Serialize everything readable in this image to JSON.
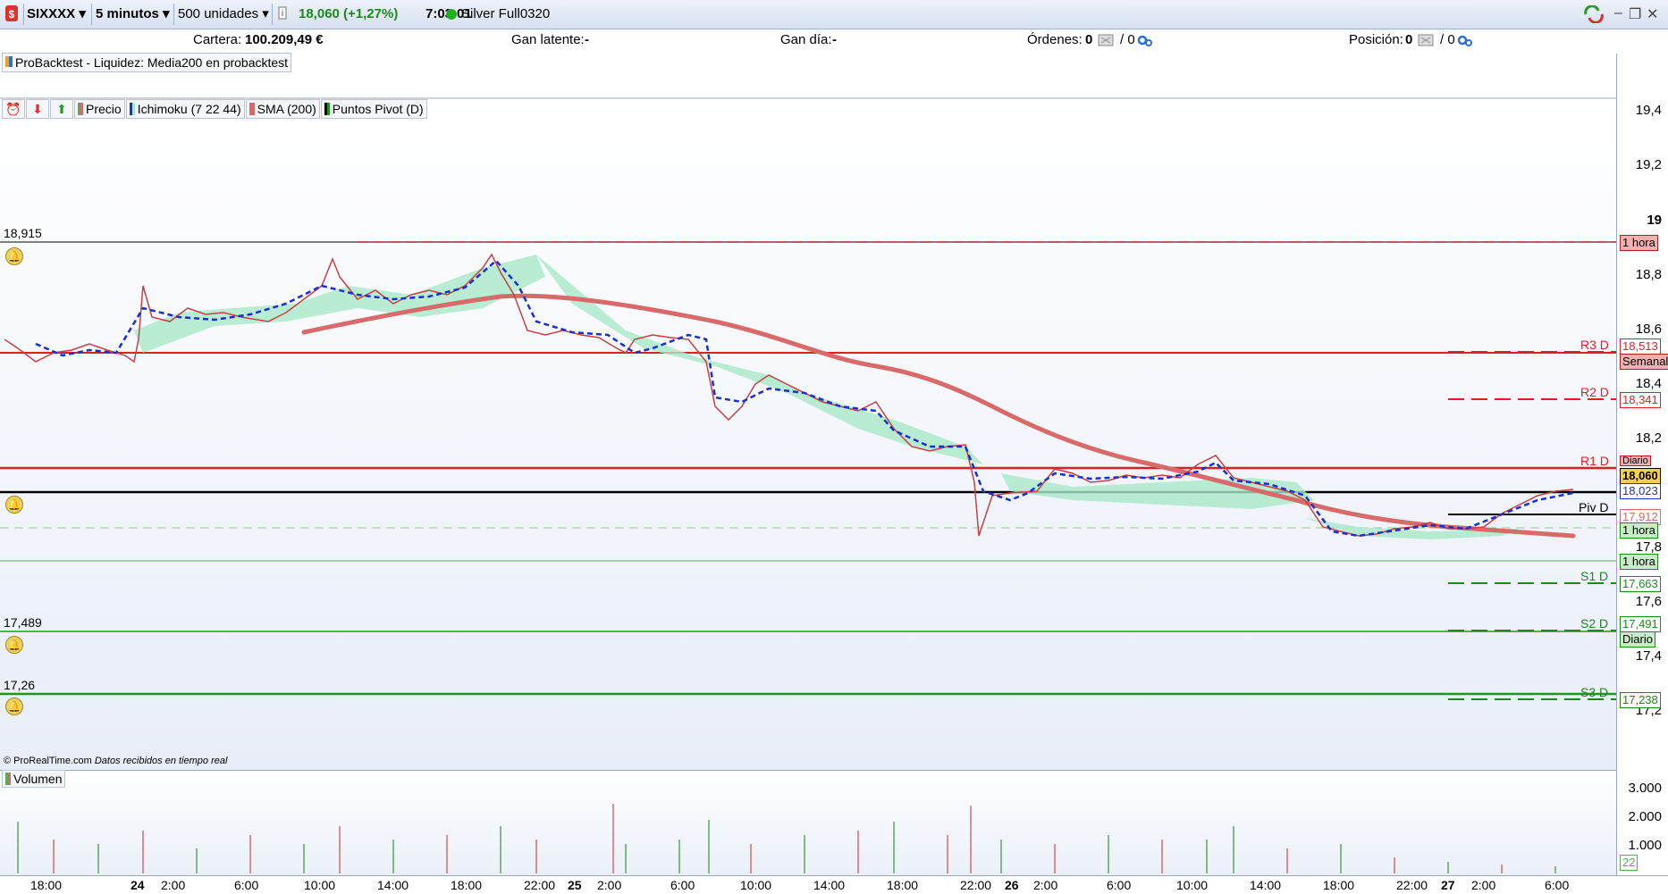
{
  "toolbar": {
    "symbol": "SIXXXX",
    "interval": "5 minutos",
    "units": "500 unidades",
    "price": "18,060 (+1,27%)",
    "time": "7:03:01",
    "feed": "Silver Full0320",
    "price_color": "#1a8a1a"
  },
  "infobar": {
    "cartera_label": "Cartera:",
    "cartera_value": "100.209,49 €",
    "gan_latente_label": "Gan latente:",
    "gan_latente_value": "-",
    "gan_dia_label": "Gan día:",
    "gan_dia_value": "-",
    "ordenes_label": "Órdenes:",
    "ordenes_value1": "0",
    "ordenes_value2": "/ 0",
    "posicion_label": "Posición:",
    "posicion_value1": "0",
    "posicion_value2": "/ 0"
  },
  "probacktest": "ProBacktest - Liquidez: Media200 en probacktest",
  "legend": {
    "precio": "Precio",
    "ichimoku": "Ichimoku (7 22 44)",
    "sma": "SMA (200)",
    "pivot": "Puntos Pivot (D)",
    "volumen": "Volumen"
  },
  "copyright": "© ProRealTime.com",
  "realtime": "Datos recibidos en tiempo real",
  "price_axis": [
    "19,4",
    "19,2",
    "19",
    "18,8",
    "18,6",
    "18,4",
    "18,2",
    "17,8",
    "17,6",
    "17,4",
    "17,2"
  ],
  "volume_axis": [
    "3.000",
    "2.000",
    "1.000"
  ],
  "volume_current": "22",
  "alert_levels": {
    "a1": "18,915",
    "a2": "17,489",
    "a3": "17,26"
  },
  "pivots": {
    "r3": "R3 D",
    "r2": "R2 D",
    "r1": "R1 D",
    "piv": "Piv D",
    "s1": "S1 D",
    "s2": "S2 D",
    "s3": "S3 D"
  },
  "price_tags": {
    "hora1": "1 hora",
    "r3": "18,513",
    "semanal": "Semanal",
    "r2": "18,341",
    "diario_top": "Diario",
    "last": "18,060",
    "ichi": "18,023",
    "piv": "17,912",
    "hora2": "1 hora",
    "hora3": "1 hora",
    "s1": "17,663",
    "s2": "17,491",
    "diario": "Diario",
    "s3": "17,238"
  },
  "time_axis": [
    "18:00",
    "24",
    "2:00",
    "6:00",
    "10:00",
    "14:00",
    "18:00",
    "22:00",
    "25",
    "2:00",
    "6:00",
    "10:00",
    "14:00",
    "18:00",
    "22:00",
    "26",
    "2:00",
    "6:00",
    "10:00",
    "14:00",
    "18:00",
    "22:00",
    "27",
    "2:00",
    "6:00"
  ],
  "colors": {
    "sma": "#d96a6a",
    "kijun": "#1a2fd0",
    "cloud": "#a7e8c8",
    "resistance": "#e02020",
    "support": "#1a9a1a",
    "pivot": "#000000"
  },
  "chart_data": {
    "type": "line",
    "title": "SIXXXX 5 minutos",
    "xlabel": "",
    "ylabel": "",
    "ylim": [
      17.1,
      19.45
    ],
    "series": [
      {
        "name": "Precio",
        "x": [
          "18:00",
          "24 2:00",
          "24 10:00",
          "24 18:00",
          "24 20:00",
          "25 2:00",
          "25 6:00",
          "25 10:00",
          "25 18:00",
          "25 22:00",
          "26 2:00",
          "26 10:00",
          "26 14:00",
          "26 18:00",
          "26 22:00",
          "27 2:00",
          "27 6:00"
        ],
        "values": [
          18.52,
          18.5,
          18.78,
          18.9,
          18.88,
          18.48,
          18.55,
          18.4,
          18.25,
          17.9,
          18.05,
          18.12,
          17.82,
          17.82,
          17.87,
          17.92,
          18.06
        ]
      },
      {
        "name": "SMA (200)",
        "x": [
          "24 10:00",
          "24 18:00",
          "25 6:00",
          "25 18:00",
          "26 2:00",
          "26 14:00",
          "27 6:00"
        ],
        "values": [
          18.56,
          18.7,
          18.6,
          18.3,
          18.08,
          17.98,
          17.9
        ]
      }
    ]
  }
}
